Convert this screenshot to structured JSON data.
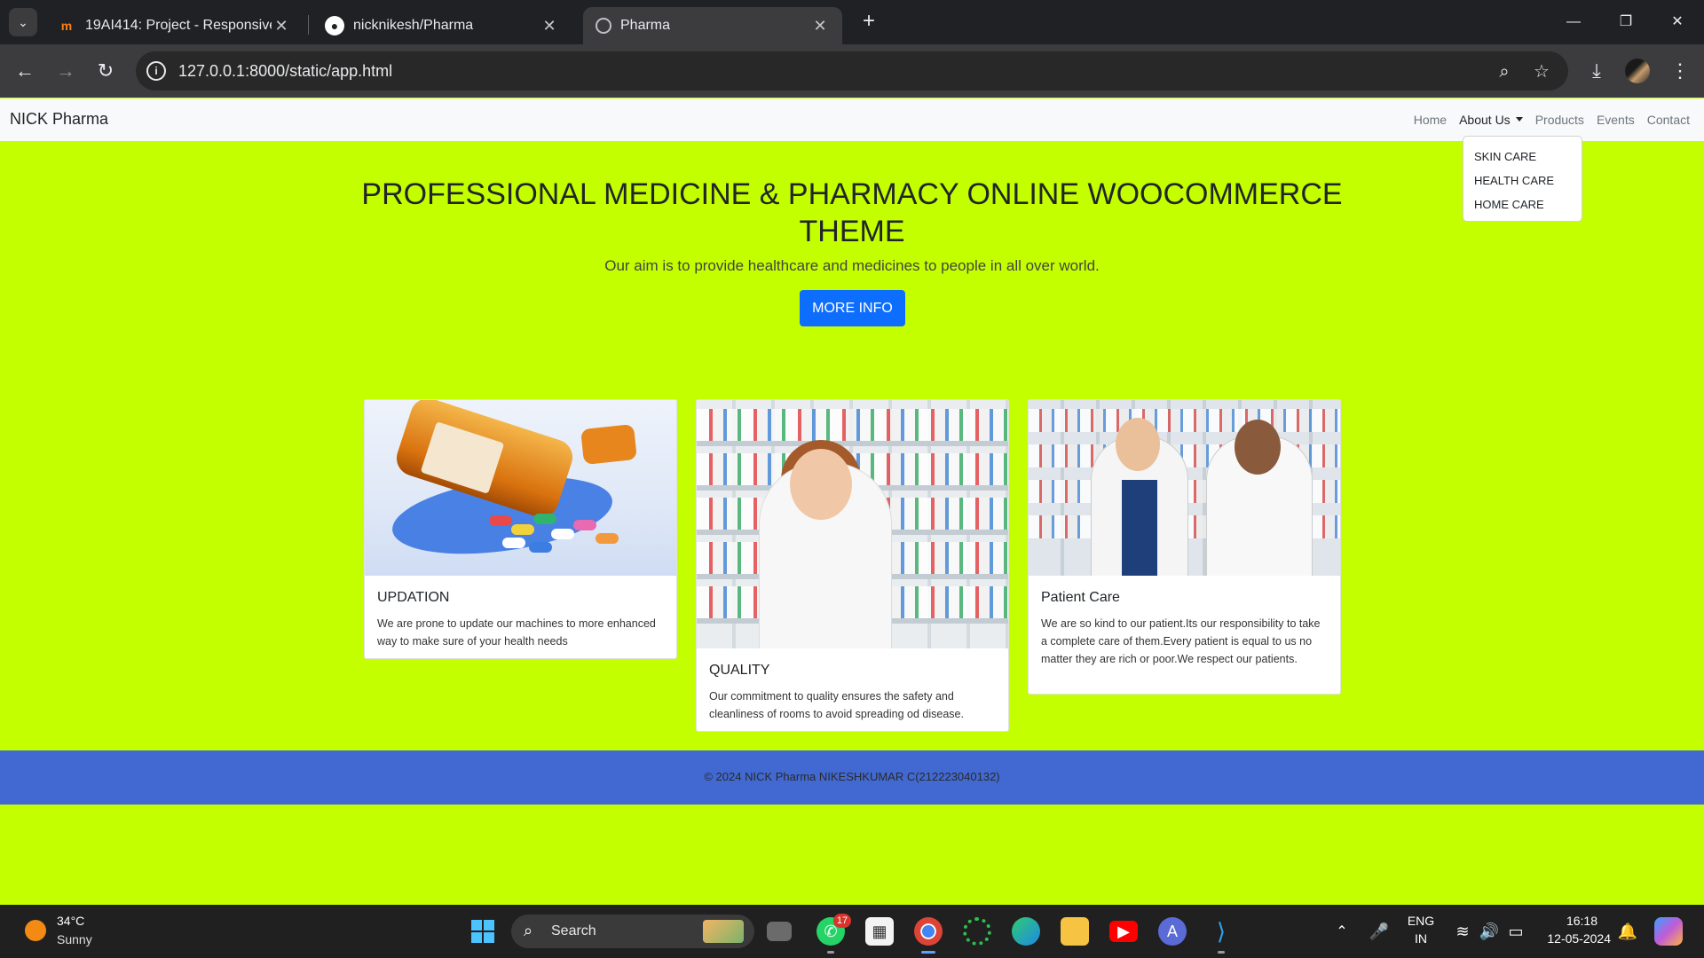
{
  "browser": {
    "tabs": [
      {
        "title": "19AI414: Project - Responsive W",
        "icon": "moodle-icon"
      },
      {
        "title": "nicknikesh/Pharma",
        "icon": "github-icon"
      },
      {
        "title": "Pharma",
        "icon": "globe-icon",
        "active": true
      }
    ],
    "url": "127.0.0.1:8000/static/app.html"
  },
  "site": {
    "brand": "NICK Pharma",
    "nav": [
      "Home",
      "About Us",
      "Products",
      "Events",
      "Contact"
    ],
    "dropdown": [
      "SKIN CARE",
      "HEALTH CARE",
      "HOME CARE"
    ],
    "hero": {
      "title": "PROFESSIONAL MEDICINE & PHARMACY ONLINE WOOCOMMERCE THEME",
      "subtitle": "Our aim is to provide healthcare and medicines to people in all over world.",
      "button": "MORE INFO"
    },
    "cards": [
      {
        "title": "UPDATION",
        "text": "We are prone to update our machines to more enhanced way to make sure of your health needs"
      },
      {
        "title": "QUALITY",
        "text": "Our commitment to quality ensures the safety and cleanliness of rooms to avoid spreading od disease."
      },
      {
        "title": "Patient Care",
        "text": "We are so kind to our patient.Its our responsibility to take a complete care of them.Every patient is equal to us no matter they are rich or poor.We respect our patients."
      }
    ],
    "footer": "© 2024 NICK Pharma NIKESHKUMAR C(212223040132)"
  },
  "taskbar": {
    "weather": {
      "temp": "34°C",
      "desc": "Sunny"
    },
    "search": "Search",
    "whatsapp_badge": "17",
    "lang": "ENG",
    "region": "IN",
    "time": "16:18",
    "date": "12-05-2024"
  },
  "colors": {
    "page_bg": "#c4ff00",
    "footer_bg": "#4169d1",
    "primary_button": "#0d6efd"
  }
}
